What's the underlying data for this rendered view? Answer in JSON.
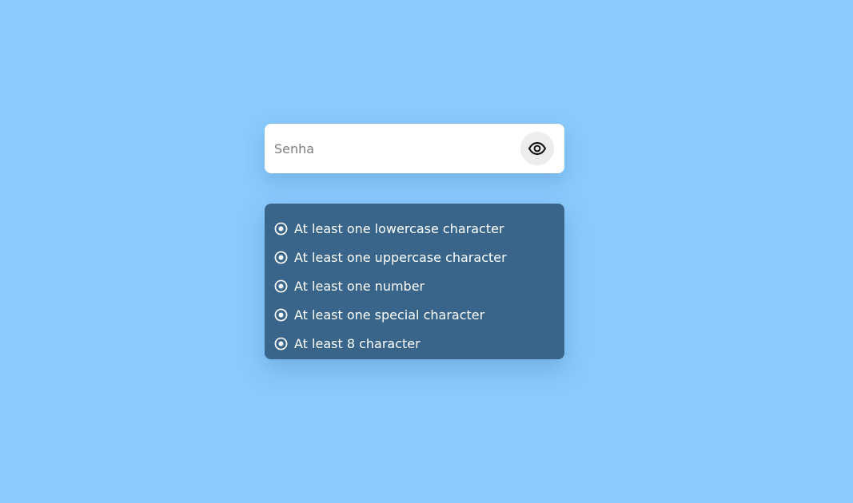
{
  "password": {
    "placeholder": "Senha",
    "value": "",
    "toggle_icon": "eye-icon"
  },
  "requirements": {
    "icon": "radio-icon",
    "items": [
      {
        "label": "At least one lowercase character"
      },
      {
        "label": "At least one uppercase character"
      },
      {
        "label": "At least one number"
      },
      {
        "label": "At least one special character"
      },
      {
        "label": "At least 8 character"
      }
    ]
  },
  "colors": {
    "background": "#8acafe",
    "card": "#ffffff",
    "requirements_bg": "#386589",
    "text_light": "#ffffff"
  }
}
